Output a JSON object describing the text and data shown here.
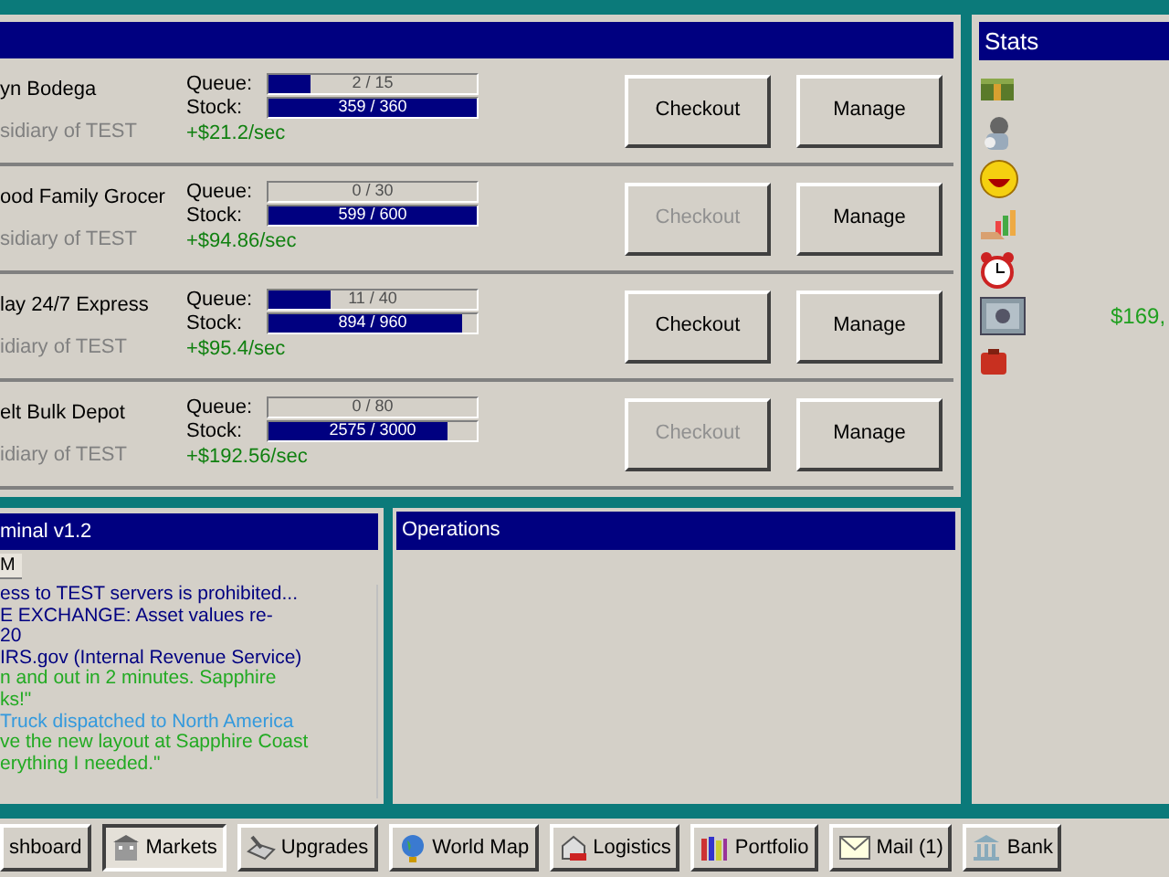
{
  "stores": [
    {
      "name": "yn Bodega",
      "subtitle": "sidiary of TEST",
      "queue": {
        "label": "Queue:",
        "text": "2 / 15",
        "level": 0.2
      },
      "stock": {
        "label": "Stock:",
        "text": "359 / 360",
        "level": 1
      },
      "rate": "+$21.2/sec",
      "checkout": {
        "label": "Checkout",
        "disabled": false
      },
      "manage": "Manage"
    },
    {
      "name": "ood Family Grocer",
      "subtitle": "sidiary of TEST",
      "queue": {
        "label": "Queue:",
        "text": "0 / 30",
        "level": 0
      },
      "stock": {
        "label": "Stock:",
        "text": "599 / 600",
        "level": 1
      },
      "rate": "+$94.86/sec",
      "checkout": {
        "label": "Checkout",
        "disabled": true
      },
      "manage": "Manage"
    },
    {
      "name": "lay 24/7 Express",
      "subtitle": "idiary of TEST",
      "queue": {
        "label": "Queue:",
        "text": "11 / 40",
        "level": 0.3
      },
      "stock": {
        "label": "Stock:",
        "text": "894 / 960",
        "level": 0.93
      },
      "rate": "+$95.4/sec",
      "checkout": {
        "label": "Checkout",
        "disabled": false
      },
      "manage": "Manage"
    },
    {
      "name": "elt Bulk Depot",
      "subtitle": "idiary of TEST",
      "queue": {
        "label": "Queue:",
        "text": "0 / 80",
        "level": 0
      },
      "stock": {
        "label": "Stock:",
        "text": "2575 / 3000",
        "level": 0.86
      },
      "rate": "+$192.56/sec",
      "checkout": {
        "label": "Checkout",
        "disabled": true
      },
      "manage": "Manage"
    }
  ],
  "stats": {
    "title": "Stats",
    "rows": [
      {
        "kind": "money"
      },
      {
        "kind": "worker"
      },
      {
        "kind": "smiley"
      },
      {
        "kind": "growth"
      },
      {
        "kind": "clock"
      },
      {
        "kind": "safe",
        "value": "$169,"
      },
      {
        "kind": "case"
      }
    ]
  },
  "terminal": {
    "title": "minal v1.2",
    "tab": "M",
    "lines": [
      {
        "text": "ess to TEST servers is prohibited...",
        "color": "#000080"
      },
      {
        "text": "E EXCHANGE: Asset values re-",
        "color": "#000080"
      },
      {
        "text": "20",
        "color": "#000080"
      },
      {
        "text": "IRS.gov (Internal Revenue Service)",
        "color": "#000080"
      },
      {
        "text": "n and out in 2 minutes. Sapphire",
        "color": "#22aa22"
      },
      {
        "text": "ks!\"",
        "color": "#22aa22"
      },
      {
        "text": "Truck dispatched to North America",
        "color": "#3399dd"
      },
      {
        "text": "ve the new layout at Sapphire Coast",
        "color": "#22aa22"
      },
      {
        "text": "erything I needed.\"",
        "color": "#22aa22"
      }
    ]
  },
  "operations": {
    "title": "Operations"
  },
  "taskbar": [
    {
      "label": "shboard",
      "kind": "plain",
      "selected": false
    },
    {
      "label": "Markets",
      "kind": "market",
      "selected": true
    },
    {
      "label": "Upgrades",
      "kind": "tool",
      "selected": false
    },
    {
      "label": "World Map",
      "kind": "globe",
      "selected": false
    },
    {
      "label": "Logistics",
      "kind": "house",
      "selected": false
    },
    {
      "label": "Portfolio",
      "kind": "books",
      "selected": false
    },
    {
      "label": "Mail (1)",
      "kind": "mail",
      "selected": false
    },
    {
      "label": "Bank",
      "kind": "bank",
      "selected": false
    }
  ]
}
